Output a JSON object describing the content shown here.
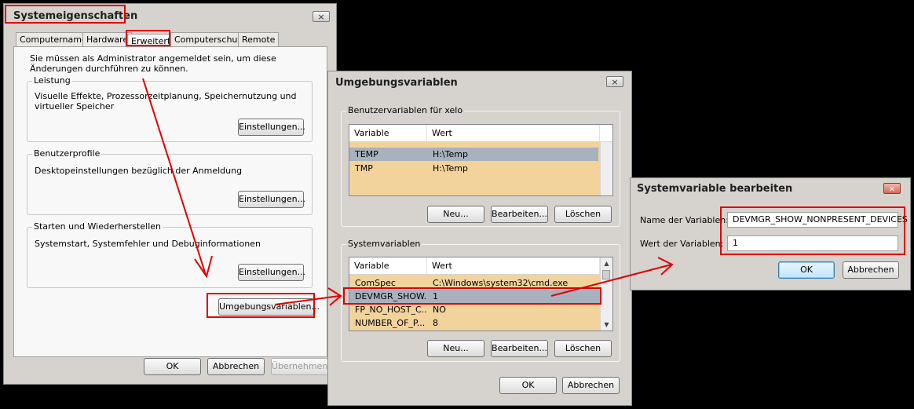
{
  "sysprops": {
    "title": "Systemeigenschaften",
    "close": "×",
    "tabs": [
      "Computername",
      "Hardware",
      "Erweitert",
      "Computerschutz",
      "Remote"
    ],
    "admin_notice": "Sie müssen als Administrator angemeldet sein, um diese Änderungen durchführen zu können.",
    "performance": {
      "title": "Leistung",
      "desc": "Visuelle Effekte, Prozessorzeitplanung, Speichernutzung und virtueller Speicher",
      "button": "Einstellungen..."
    },
    "profiles": {
      "title": "Benutzerprofile",
      "desc": "Desktopeinstellungen bezüglich der Anmeldung",
      "button": "Einstellungen..."
    },
    "startup": {
      "title": "Starten und Wiederherstellen",
      "desc": "Systemstart, Systemfehler und Debuginformationen",
      "button": "Einstellungen..."
    },
    "env_button": "Umgebungsvariablen...",
    "ok": "OK",
    "cancel": "Abbrechen",
    "apply": "Übernehmen"
  },
  "envvars": {
    "title": "Umgebungsvariablen",
    "close": "×",
    "user_group": "Benutzervariablen für xelo",
    "col_variable": "Variable",
    "col_value": "Wert",
    "user_vars": [
      {
        "name": "TEMP",
        "value": "H:\\Temp"
      },
      {
        "name": "TMP",
        "value": "H:\\Temp"
      }
    ],
    "system_group": "Systemvariablen",
    "system_vars": [
      {
        "name": "ComSpec",
        "value": "C:\\Windows\\system32\\cmd.exe"
      },
      {
        "name": "DEVMGR_SHOW...",
        "value": "1"
      },
      {
        "name": "FP_NO_HOST_C...",
        "value": "NO"
      },
      {
        "name": "NUMBER_OF_P...",
        "value": "8"
      }
    ],
    "new": "Neu...",
    "edit": "Bearbeiten...",
    "delete": "Löschen",
    "ok": "OK",
    "cancel": "Abbrechen"
  },
  "editvar": {
    "title": "Systemvariable bearbeiten",
    "close": "×",
    "name_label": "Name der Variablen:",
    "name_value": "DEVMGR_SHOW_NONPRESENT_DEVICES",
    "value_label": "Wert der Variablen:",
    "value_value": "1",
    "ok": "OK",
    "cancel": "Abbrechen"
  },
  "colors": {
    "highlight": "#e00000",
    "list_bg": "#f2d39c",
    "selection": "#a8b1bd"
  }
}
